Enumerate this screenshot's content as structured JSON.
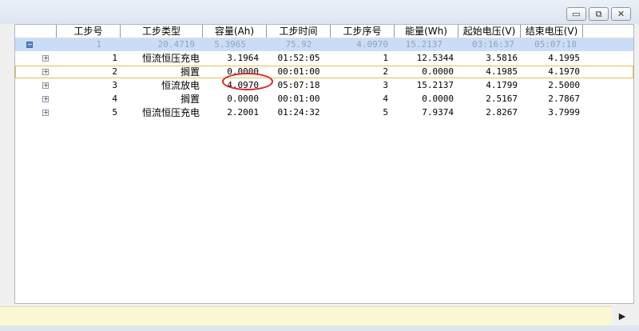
{
  "window": {
    "minimize_glyph": "▭",
    "restore_glyph": "⧉",
    "close_glyph": "✕"
  },
  "columns": [
    "工步号",
    "工步类型",
    "容量(Ah)",
    "工步时间",
    "工步序号",
    "能量(Wh)",
    "起始电压(V)",
    "结束电压(V)"
  ],
  "summary": {
    "step_no": "1",
    "step_type": "20.4719",
    "capacity": "5.3965",
    "step_time": "75.92",
    "step_seq": "4.0970",
    "energy": "15.2137",
    "start_voltage": "03:16:37",
    "end_voltage": "05:07:18"
  },
  "rows": [
    {
      "step_no": "1",
      "step_type": "恒流恒压充电",
      "capacity": "3.1964",
      "step_time": "01:52:05",
      "step_seq": "1",
      "energy": "12.5344",
      "start_voltage": "3.5816",
      "end_voltage": "4.1995"
    },
    {
      "step_no": "2",
      "step_type": "搁置",
      "capacity": "0.0000",
      "step_time": "00:01:00",
      "step_seq": "2",
      "energy": "0.0000",
      "start_voltage": "4.1985",
      "end_voltage": "4.1970"
    },
    {
      "step_no": "3",
      "step_type": "恒流放电",
      "capacity": "4.0970",
      "step_time": "05:07:18",
      "step_seq": "3",
      "energy": "15.2137",
      "start_voltage": "4.1799",
      "end_voltage": "2.5000"
    },
    {
      "step_no": "4",
      "step_type": "搁置",
      "capacity": "0.0000",
      "step_time": "00:01:00",
      "step_seq": "4",
      "energy": "0.0000",
      "start_voltage": "2.5167",
      "end_voltage": "2.7867"
    },
    {
      "step_no": "5",
      "step_type": "恒流恒压充电",
      "capacity": "2.2001",
      "step_time": "01:24:32",
      "step_seq": "5",
      "energy": "7.9374",
      "start_voltage": "2.8267",
      "end_voltage": "3.7999"
    }
  ],
  "expander_plus": "+",
  "expander_minus": "−",
  "scroll_right_glyph": "▶",
  "colors": {
    "selection_bg": "#c9ddf7",
    "annotation": "#e02020",
    "selected_border": "#e0c24a"
  }
}
